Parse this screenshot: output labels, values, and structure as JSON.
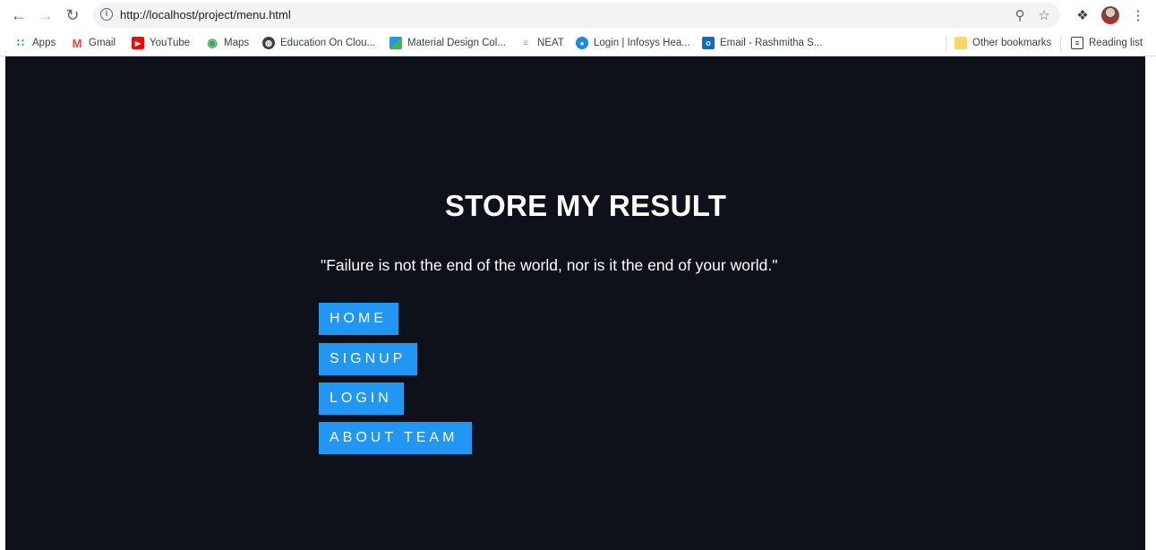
{
  "browser": {
    "url": "http://localhost/project/menu.html",
    "bookmarks": [
      {
        "label": "Apps",
        "icon": "apps-grid-icon",
        "color": "#1a73e8"
      },
      {
        "label": "Gmail",
        "icon": "gmail-icon",
        "color": "#ea4335"
      },
      {
        "label": "YouTube",
        "icon": "youtube-icon",
        "color": "#ff0000"
      },
      {
        "label": "Maps",
        "icon": "maps-pin-icon",
        "color": "#34a853"
      },
      {
        "label": "Education On Clou...",
        "icon": "globe-icon",
        "color": "#3c4043"
      },
      {
        "label": "Material Design Col...",
        "icon": "material-design-icon",
        "color": "#2196f3"
      },
      {
        "label": "NEAT",
        "icon": "neat-icon",
        "color": "#9aa0a6"
      },
      {
        "label": "Login | Infosys Hea...",
        "icon": "infosys-icon",
        "color": "#1e88e5"
      },
      {
        "label": "Email - Rashmitha S...",
        "icon": "outlook-icon",
        "color": "#0f6cbd"
      }
    ],
    "other_bookmarks": "Other bookmarks",
    "reading_list": "Reading list"
  },
  "page": {
    "title": "STORE MY RESULT",
    "quote": "\"Failure is not the end of the world, nor is it the end of your world.\"",
    "menu": [
      {
        "label": "HOME"
      },
      {
        "label": "SIGNUP"
      },
      {
        "label": "LOGIN"
      },
      {
        "label": "ABOUT TEAM"
      }
    ],
    "colors": {
      "background": "#0f111a",
      "button": "#2196f3",
      "text": "#ffffff"
    }
  }
}
